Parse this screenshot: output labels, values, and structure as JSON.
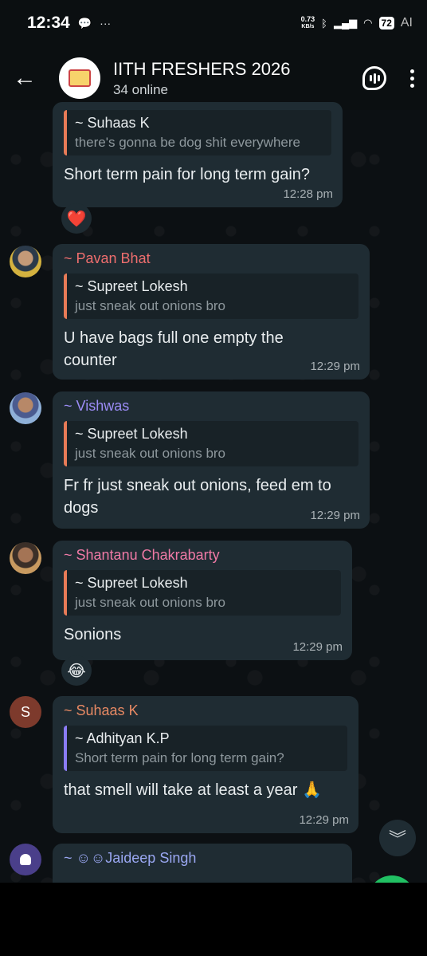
{
  "status_bar": {
    "time": "12:34",
    "net_speed_value": "0.73",
    "net_speed_unit": "KB/s",
    "battery": "72",
    "ai_label": "AI"
  },
  "header": {
    "title": "IITH FRESHERS 2026",
    "subtitle": "34 online"
  },
  "messages": [
    {
      "quote_name": "~ Suhaas K",
      "quote_text": "there's gonna be dog shit everywhere",
      "text": "Short term pain for long term gain?",
      "time": "12:28 pm",
      "reaction": "❤️"
    },
    {
      "sender": "~ Pavan Bhat",
      "quote_name": "~ Supreet Lokesh",
      "quote_text": "just sneak out onions bro",
      "text": "U have bags full one empty the counter",
      "time": "12:29 pm"
    },
    {
      "sender": "~ Vishwas",
      "quote_name": "~ Supreet Lokesh",
      "quote_text": "just sneak out onions bro",
      "text": "Fr fr just sneak out onions, feed em to dogs",
      "time": "12:29 pm"
    },
    {
      "sender": "~ Shantanu Chakrabarty",
      "quote_name": "~ Supreet Lokesh",
      "quote_text": "just sneak out onions bro",
      "text": "Sonions",
      "time": "12:29 pm",
      "reaction": "😂"
    },
    {
      "sender": "~ Suhaas K",
      "avatar_letter": "S",
      "quote_name": "~ Adhityan K.P",
      "quote_text": "Short term pain for long term gain?",
      "text": "that smell will take at least a year 🙏",
      "time": "12:29 pm"
    },
    {
      "sender": "~ ☺☺Jaideep Singh"
    }
  ],
  "colors": {
    "bubble": "#1f2c33",
    "quote_orange": "#e87b57",
    "quote_purple": "#8b7cf6",
    "sender_pavan": "#ef6e6e",
    "sender_vishwas": "#9b8cf5",
    "sender_shantanu": "#f07aa6",
    "sender_suhaas": "#e98a64",
    "sender_jaideep": "#9aa7f2"
  },
  "icons": {
    "back": "arrow-left-icon",
    "voice_chat": "voice-chat-icon",
    "menu": "more-vert-icon",
    "scroll_down": "chevron-double-down-icon"
  }
}
